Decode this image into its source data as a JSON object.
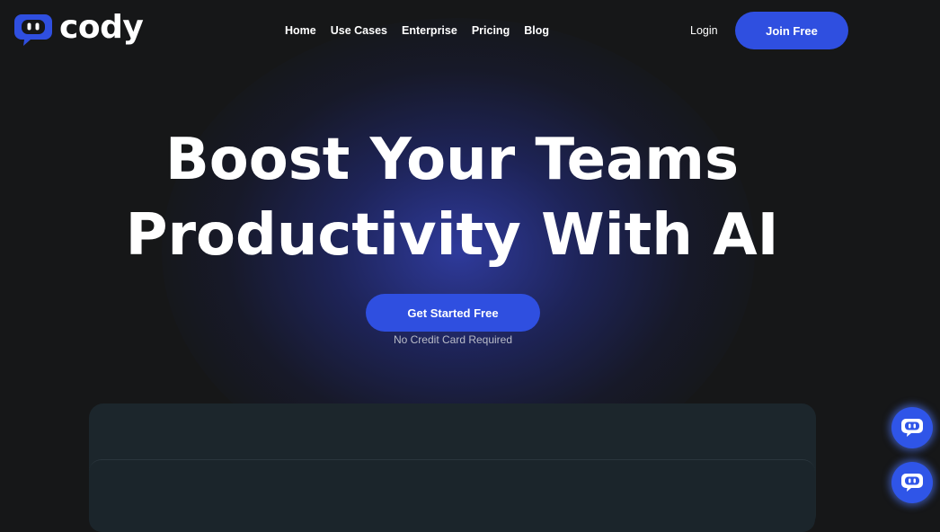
{
  "brand": {
    "name": "cody",
    "logo_icon": "chat-bot-icon",
    "accent_color": "#2f4fe0"
  },
  "nav": {
    "links": [
      "Home",
      "Use Cases",
      "Enterprise",
      "Pricing",
      "Blog"
    ],
    "login_label": "Login",
    "join_label": "Join Free"
  },
  "hero": {
    "title_line1": "Boost Your Teams",
    "title_line2": "Productivity With AI",
    "cta_label": "Get Started Free",
    "cta_note": "No Credit Card Required"
  },
  "chat_widgets": [
    {
      "icon": "chat-bot-icon"
    },
    {
      "icon": "chat-bot-icon"
    }
  ]
}
